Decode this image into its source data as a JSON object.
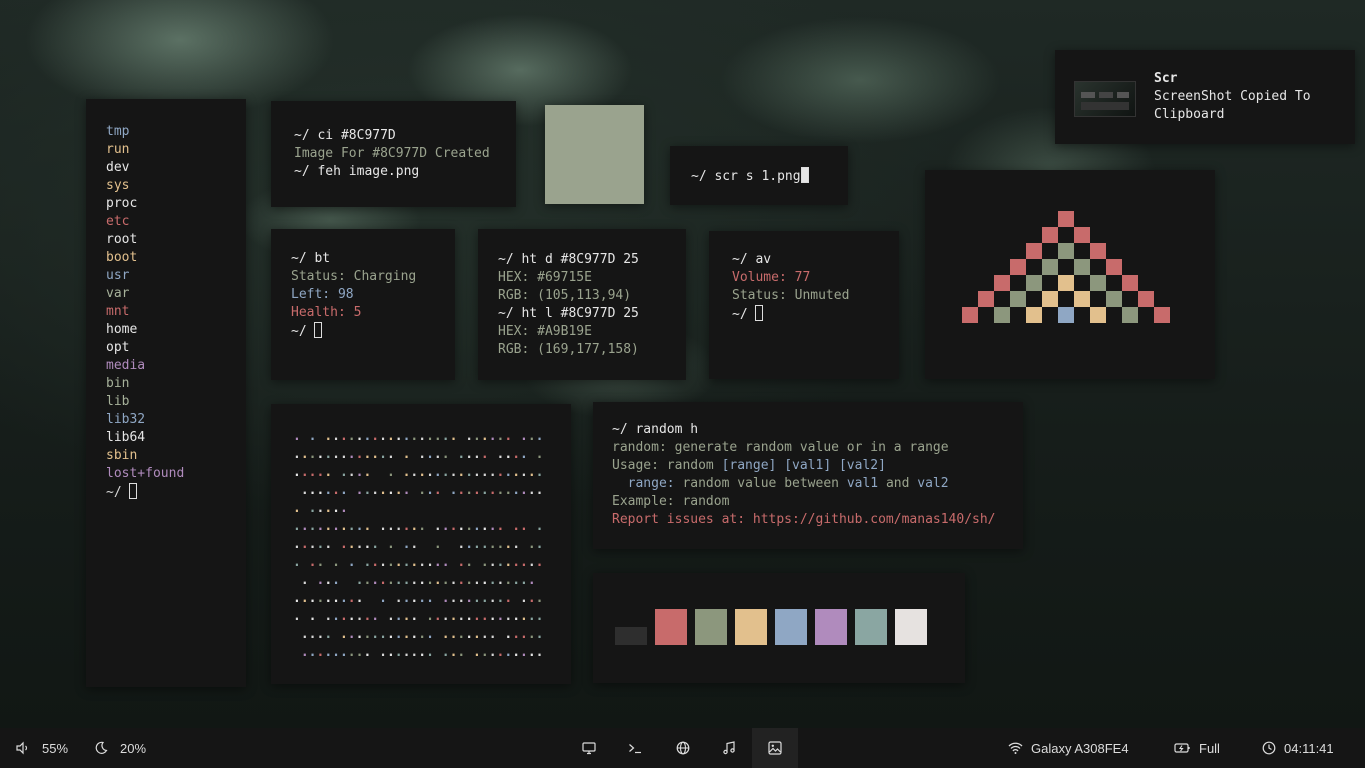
{
  "dirlist": {
    "entries": [
      {
        "name": "tmp",
        "color": "#8fa7c4"
      },
      {
        "name": "run",
        "color": "#e2c08d"
      },
      {
        "name": "dev",
        "color": "#e6e6e6"
      },
      {
        "name": "sys",
        "color": "#e2c08d"
      },
      {
        "name": "proc",
        "color": "#e6e6e6"
      },
      {
        "name": "etc",
        "color": "#c86b6b"
      },
      {
        "name": "root",
        "color": "#e6e6e6"
      },
      {
        "name": "boot",
        "color": "#e2c08d"
      },
      {
        "name": "usr",
        "color": "#8fa7c4"
      },
      {
        "name": "var",
        "color": "#a6b19a"
      },
      {
        "name": "mnt",
        "color": "#c86b6b"
      },
      {
        "name": "home",
        "color": "#e6e6e6"
      },
      {
        "name": "opt",
        "color": "#e6e6e6"
      },
      {
        "name": "media",
        "color": "#b08bbd"
      },
      {
        "name": "bin",
        "color": "#a6b19a"
      },
      {
        "name": "lib",
        "color": "#a6b19a"
      },
      {
        "name": "lib32",
        "color": "#8fa7c4"
      },
      {
        "name": "lib64",
        "color": "#e6e6e6"
      },
      {
        "name": "sbin",
        "color": "#e2c08d"
      },
      {
        "name": "lost+found",
        "color": "#b08bbd"
      }
    ],
    "prompt": "~/ "
  },
  "ci": {
    "line1": "~/ ci #8C977D",
    "line2": "Image For #8C977D Created",
    "line3": "~/ feh image.png"
  },
  "preview_color": "#9aa38e",
  "scr": {
    "cmd": "~/ scr s 1.png"
  },
  "notification": {
    "title": "Scr",
    "body_line1": "ScreenShot Copied To",
    "body_line2": "Clipboard"
  },
  "bt": {
    "cmd": "~/ bt",
    "status": "Status: Charging",
    "left_label": "Left: ",
    "left_value": "98",
    "health": "Health: 5",
    "prompt": "~/ "
  },
  "ht": {
    "cmd1": "~/ ht d #8C977D 25",
    "hex1": "HEX: #69715E",
    "rgb1": "RGB: (105,113,94)",
    "cmd2": "~/ ht l #8C977D 25",
    "hex2": "HEX: #A9B19E",
    "rgb2": "RGB: (169,177,158)"
  },
  "av": {
    "cmd": "~/ av",
    "volume": "Volume: 77",
    "status": "Status: Unmuted",
    "prompt": "~/ "
  },
  "random": {
    "cmd": "~/ random h",
    "desc": "random: generate random value or in a range",
    "usage_label": "Usage: random ",
    "usage_args": "[range] [val1] [val2]",
    "range_key": "  range: ",
    "range_text": "random value between ",
    "val1": "val1",
    "and": " and ",
    "val2": "val2",
    "example": "Example: random",
    "report": "Report issues at: https://github.com/manas140/sh/"
  },
  "palette": [
    "#2e2e2e",
    "#c86b6b",
    "#8c977d",
    "#e2c08d",
    "#8fa7c4",
    "#b08bbd",
    "#8aa6a2",
    "#e6e2e0"
  ],
  "bar": {
    "volume": "55%",
    "brightness": "20%",
    "wifi": "Galaxy A308FE4",
    "battery": "Full",
    "clock": "04:11:41",
    "workspaces": [
      "monitor-icon",
      "terminal-icon",
      "globe-icon",
      "music-icon",
      "image-icon"
    ],
    "active_workspace": 4
  }
}
